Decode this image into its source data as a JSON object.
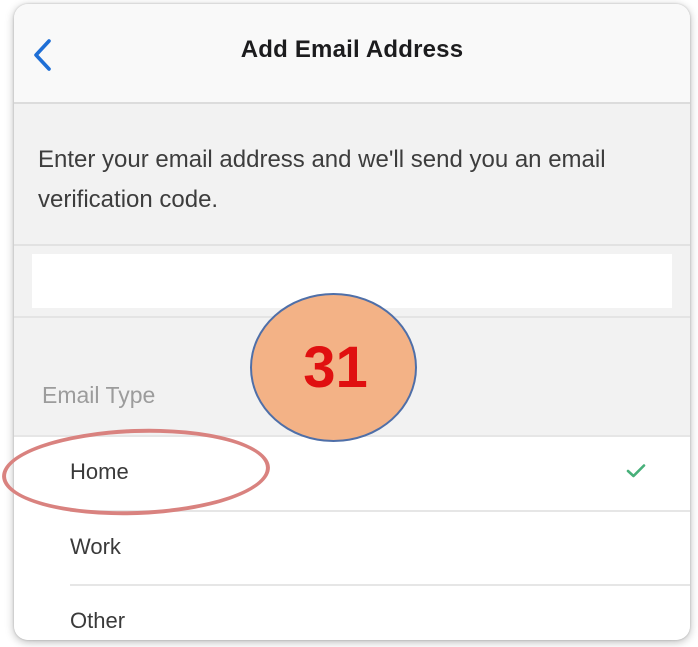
{
  "header": {
    "title": "Add Email Address",
    "back_icon": "chevron-left-icon"
  },
  "description": "Enter your email address and we'll send you an email verification code.",
  "email_field": {
    "value": "",
    "placeholder": ""
  },
  "email_type": {
    "label": "Email Type",
    "options": [
      {
        "label": "Home",
        "selected": true
      },
      {
        "label": "Work",
        "selected": false
      },
      {
        "label": "Other",
        "selected": false
      }
    ]
  },
  "annotation": {
    "step_number": "31",
    "highlight_color": "#d9827f",
    "badge_color": "#f3b286"
  },
  "colors": {
    "accent": "#1f6fd6",
    "check": "#48b07a"
  }
}
